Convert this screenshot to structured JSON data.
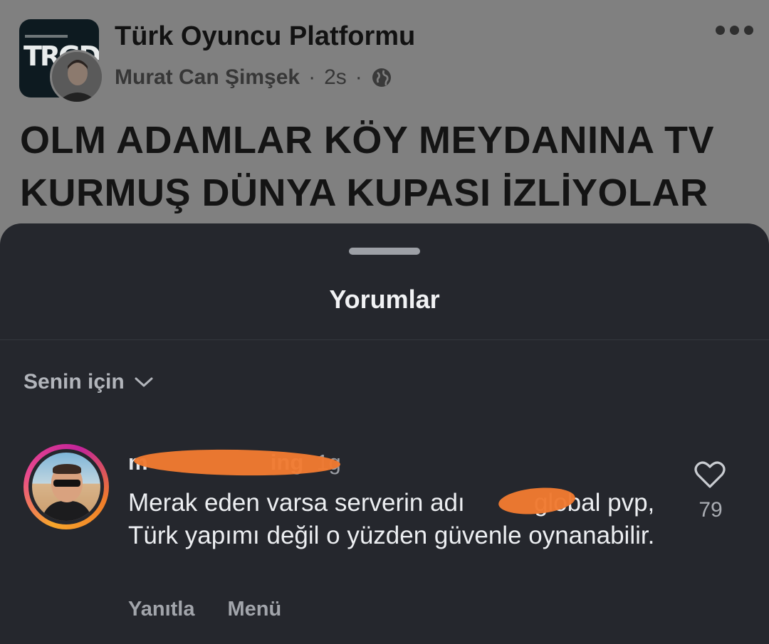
{
  "post": {
    "group_name": "Türk Oyuncu Platformu",
    "author": "Murat Can Şimşek",
    "separator": "·",
    "time": "2s",
    "headline": "OLM ADAMLAR KÖY MEYDANINA TV KURMUŞ DÜNYA KUPASI İZLİYOLAR",
    "group_logo_text": "TRGD",
    "icons": {
      "privacy": "globe-icon",
      "more": "more-options-icon"
    }
  },
  "comments_sheet": {
    "title": "Yorumlar",
    "sort_label": "Senin için",
    "comments": [
      {
        "author_visible": "m                    ing",
        "time": "1g",
        "text": "Merak eden varsa serverin adı          global pvp, Türk yapımı değil o yüzden güvenle oynanabilir.",
        "likes": "79",
        "reply_label": "Yanıtla",
        "menu_label": "Menü"
      }
    ]
  },
  "colors": {
    "sheet_bg": "#25272d",
    "dim_overlay": "#808080",
    "redaction": "#f07a31",
    "text_primary": "#eceef1",
    "text_secondary": "#a2a5ab"
  }
}
